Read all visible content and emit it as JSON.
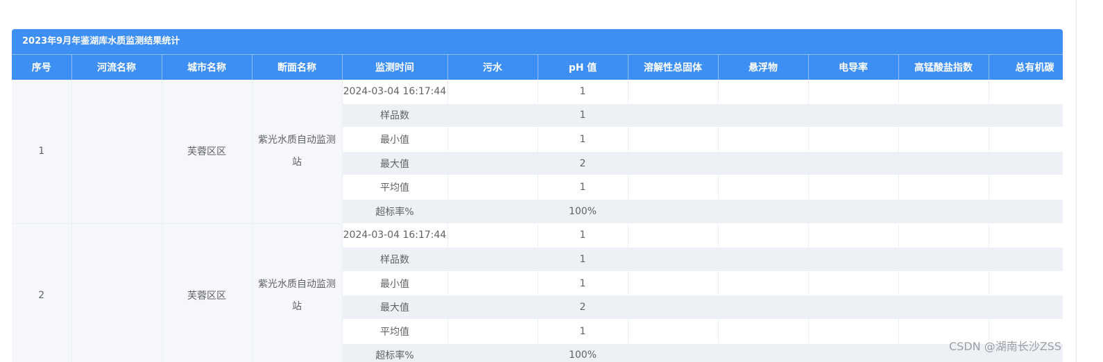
{
  "title": "2023年9月年鉴湖库水质监测结果统计",
  "columns": [
    "序号",
    "河流名称",
    "城市名称",
    "断面名称",
    "监测时间",
    "污水",
    "pH 值",
    "溶解性总固体",
    "悬浮物",
    "电导率",
    "高锰酸盐指数",
    "总有机碳"
  ],
  "groups": [
    {
      "index": "1",
      "river": "",
      "city": "芙蓉区区",
      "station": "紫光水质自动监测站",
      "rows": [
        {
          "label": "2024-03-04 16:17:44",
          "ph": "1"
        },
        {
          "label": "样品数",
          "ph": "1"
        },
        {
          "label": "最小值",
          "ph": "1"
        },
        {
          "label": "最大值",
          "ph": "2"
        },
        {
          "label": "平均值",
          "ph": "1"
        },
        {
          "label": "超标率%",
          "ph": "100%"
        }
      ]
    },
    {
      "index": "2",
      "river": "",
      "city": "芙蓉区区",
      "station": "紫光水质自动监测站",
      "rows": [
        {
          "label": "2024-03-04 16:17:44",
          "ph": "1"
        },
        {
          "label": "样品数",
          "ph": "1"
        },
        {
          "label": "最小值",
          "ph": "1"
        },
        {
          "label": "最大值",
          "ph": "2"
        },
        {
          "label": "平均值",
          "ph": "1"
        },
        {
          "label": "超标率%",
          "ph": "100%"
        }
      ]
    }
  ],
  "watermark": "CSDN @湖南长沙ZSS"
}
